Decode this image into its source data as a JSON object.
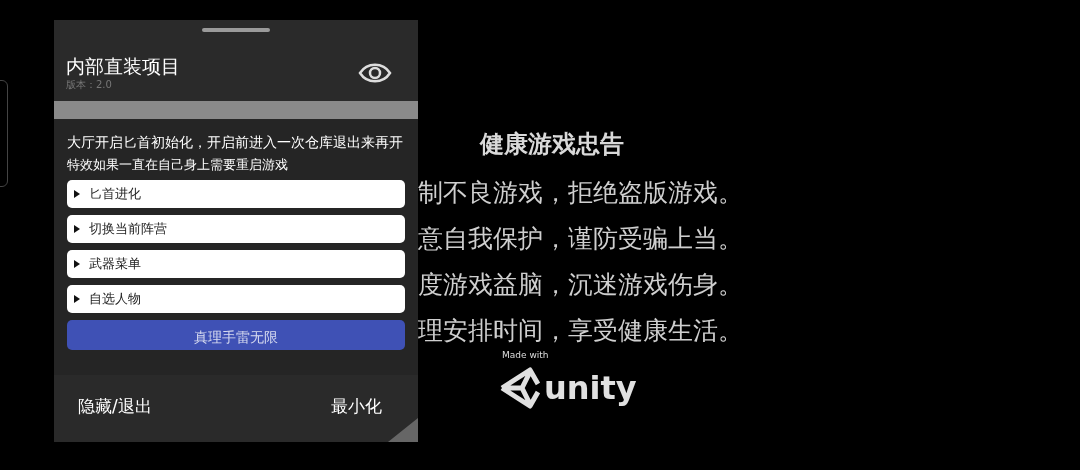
{
  "panel": {
    "title": "内部直装项目",
    "version": "版本：2.0",
    "notes": [
      "大厅开启匕首初始化，开启前进入一次仓库退出来再开",
      "特效如果一直在自己身上需要重启游戏"
    ],
    "items": [
      {
        "kind": "expander",
        "label": "匕首进化",
        "expanded": false
      },
      {
        "kind": "expander",
        "label": "切换当前阵营",
        "expanded": false
      },
      {
        "kind": "expander",
        "label": "武器菜单",
        "expanded": false
      },
      {
        "kind": "expander",
        "label": "自选人物",
        "expanded": false
      },
      {
        "kind": "action",
        "label": "真理手雷无限"
      }
    ],
    "footer": {
      "left": "隐藏/退出",
      "right": "最小化"
    }
  },
  "splash": {
    "title": "健康游戏忠告",
    "lines": [
      "制不良游戏，拒绝盗版游戏。",
      "意自我保护，谨防受骗上当。",
      "度游戏益脑，沉迷游戏伤身。",
      "理安排时间，享受健康生活。"
    ],
    "made_with": "Made with",
    "logo_text": "unity"
  }
}
